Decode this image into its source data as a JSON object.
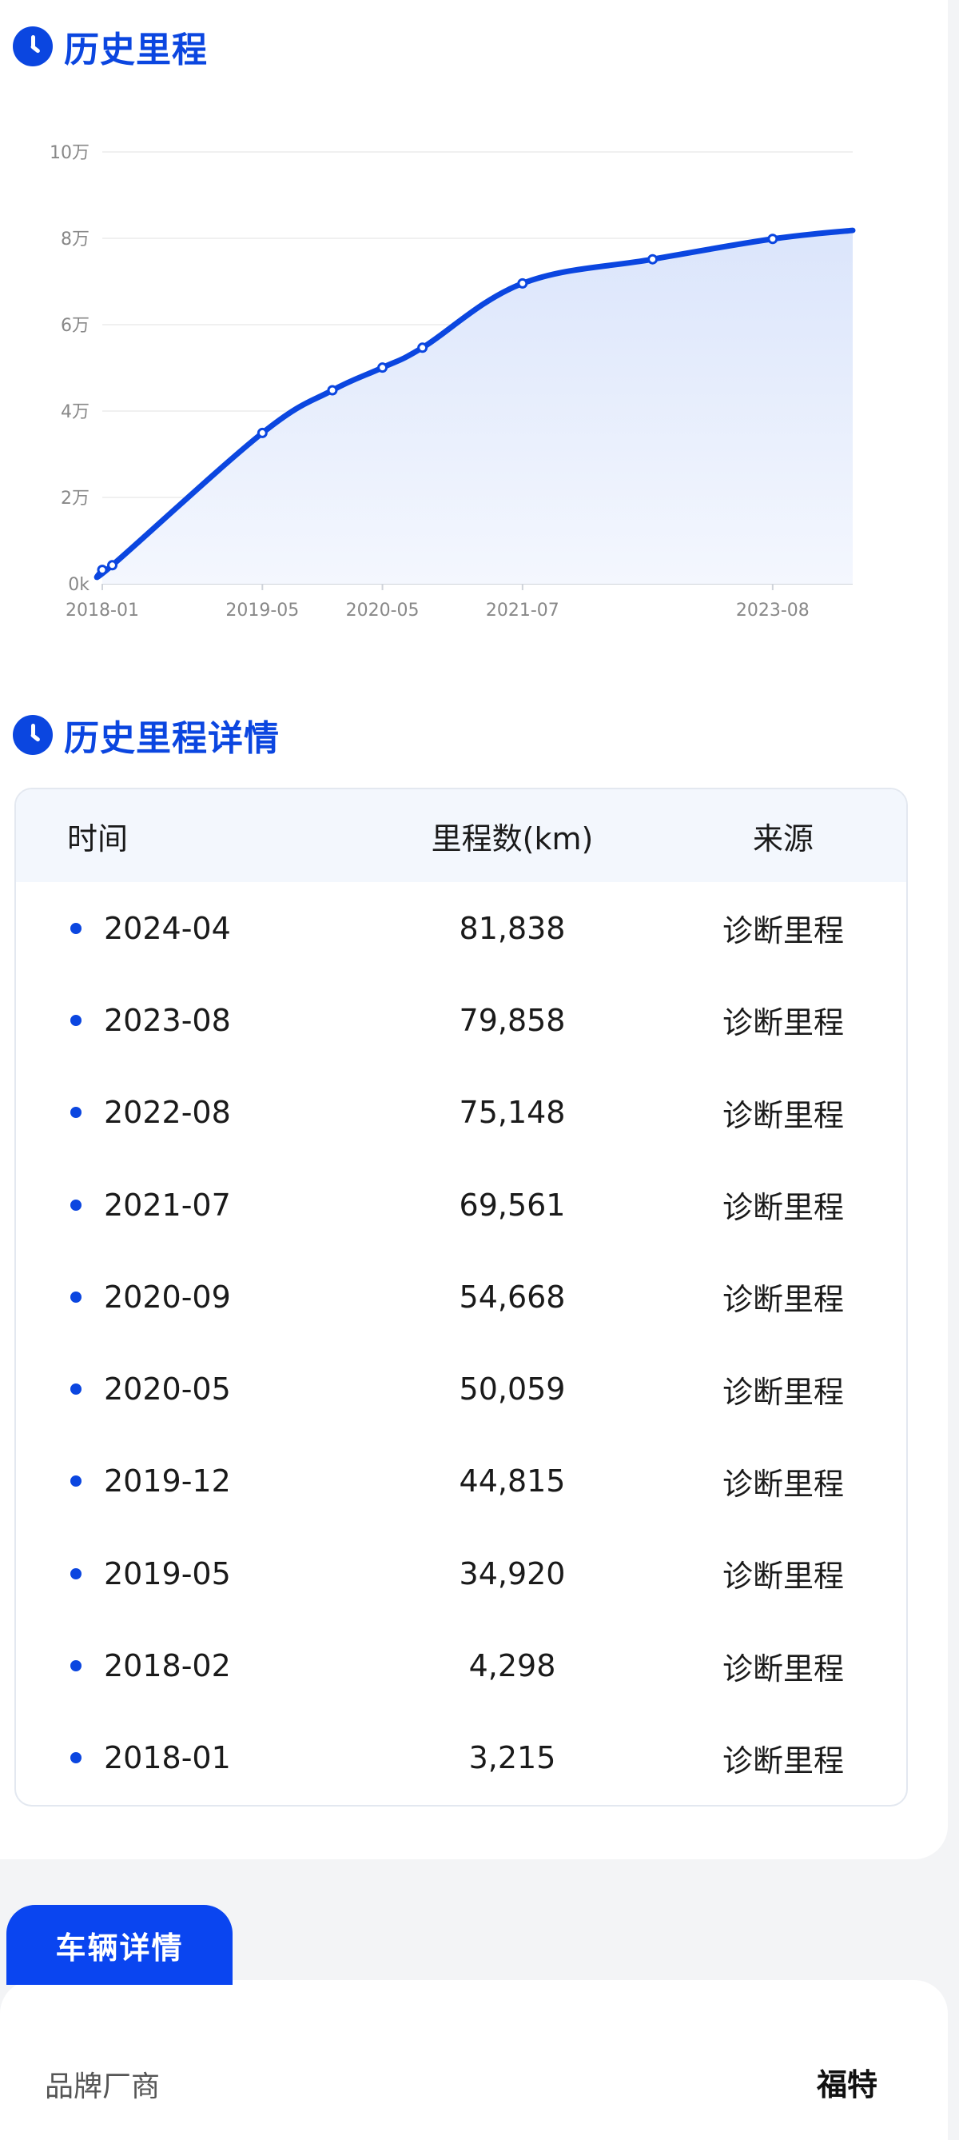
{
  "chart_section": {
    "title": "历史里程"
  },
  "chart_data": {
    "type": "area",
    "title": "",
    "xlabel": "",
    "ylabel": "",
    "y_tick_labels": [
      "0k",
      "2万",
      "4万",
      "6万",
      "8万",
      "10万"
    ],
    "y_ticks": [
      0,
      20000,
      40000,
      60000,
      80000,
      100000
    ],
    "ylim": [
      0,
      100000
    ],
    "x_tick_labels": [
      "2018-01",
      "2019-05",
      "2020-05",
      "2021-07",
      "2023-08"
    ],
    "x": [
      "2018-01",
      "2018-02",
      "2019-05",
      "2019-12",
      "2020-05",
      "2020-09",
      "2021-07",
      "2022-08",
      "2023-08",
      "2024-04"
    ],
    "values": [
      3215,
      4298,
      34920,
      44815,
      50059,
      54668,
      69561,
      75148,
      79858,
      81838
    ],
    "grid": true,
    "colors": {
      "line": "#0b46e0",
      "fill_top": "#dbe5fb",
      "fill_bottom": "#f4f7fe"
    }
  },
  "table_section": {
    "title": "历史里程详情"
  },
  "table": {
    "headers": [
      "时间",
      "里程数(km)",
      "来源"
    ],
    "rows": [
      {
        "time": "2024-04",
        "km": "81,838",
        "source": "诊断里程"
      },
      {
        "time": "2023-08",
        "km": "79,858",
        "source": "诊断里程"
      },
      {
        "time": "2022-08",
        "km": "75,148",
        "source": "诊断里程"
      },
      {
        "time": "2021-07",
        "km": "69,561",
        "source": "诊断里程"
      },
      {
        "time": "2020-09",
        "km": "54,668",
        "source": "诊断里程"
      },
      {
        "time": "2020-05",
        "km": "50,059",
        "source": "诊断里程"
      },
      {
        "time": "2019-12",
        "km": "44,815",
        "source": "诊断里程"
      },
      {
        "time": "2019-05",
        "km": "34,920",
        "source": "诊断里程"
      },
      {
        "time": "2018-02",
        "km": "4,298",
        "source": "诊断里程"
      },
      {
        "time": "2018-01",
        "km": "3,215",
        "source": "诊断里程"
      }
    ]
  },
  "vehicle_tab": {
    "label": "车辆详情"
  },
  "vehicle_detail": {
    "label": "品牌厂商",
    "value": "福特"
  },
  "icons": {
    "section": "clock-icon"
  }
}
